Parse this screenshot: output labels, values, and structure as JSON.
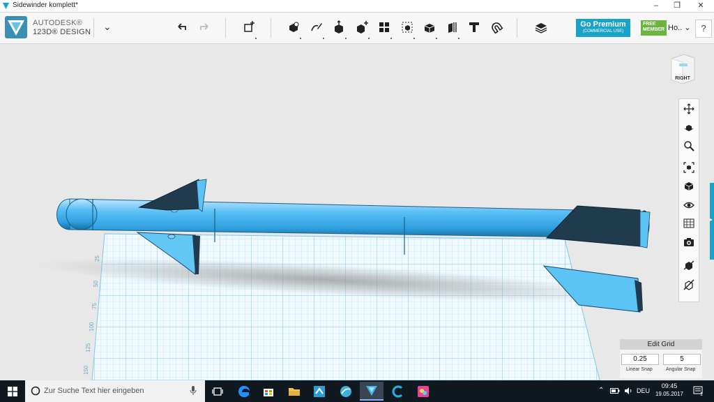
{
  "window": {
    "title": "Sidewinder komplett*",
    "minimize": "–",
    "maximize": "❐",
    "close": "✕"
  },
  "brand": {
    "line1": "AUTODESK®",
    "line2": "123D® DESIGN",
    "menu_caret": "⌄"
  },
  "premium": {
    "label": "Go Premium",
    "sublabel": "(COMMERCIAL USE)"
  },
  "member": {
    "badge_line1": "FREE",
    "badge_line2": "MEMBER",
    "user": "Ho..",
    "caret": "⌄"
  },
  "help": {
    "label": "?"
  },
  "viewcube": {
    "face": "RIGHT"
  },
  "grid_ticks": [
    "25",
    "50",
    "75",
    "100",
    "125",
    "150"
  ],
  "edit_grid": {
    "title": "Edit Grid",
    "linear_value": "0.25",
    "angular_value": "5",
    "linear_label": "Linear Snap",
    "angular_label": "Angular Snap"
  },
  "taskbar": {
    "search_placeholder": "Zur Suche Text hier eingeben",
    "language": "DEU",
    "time": "09:45",
    "date": "19.05.2017",
    "notification_count": "1"
  },
  "colors": {
    "accent": "#1aa3c9",
    "model": "#3fb1f0",
    "model_dark": "#203a4e",
    "grid": "#8fd0ee",
    "member_green": "#6bb43f"
  }
}
